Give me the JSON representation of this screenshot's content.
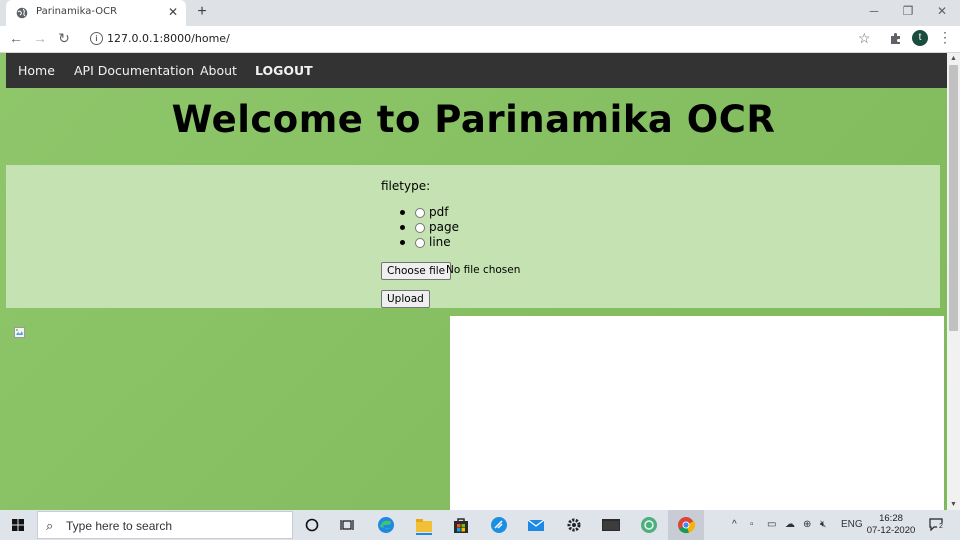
{
  "browser": {
    "tab_title": "Parinamika-OCR",
    "tab_close": "✕",
    "new_tab": "+",
    "url": "127.0.0.1:8000/home/",
    "avatar_letter": "t",
    "window_controls": {
      "minimize": "─",
      "restore": "❐",
      "close": "✕"
    }
  },
  "navbar": {
    "items": [
      {
        "label": "Home"
      },
      {
        "label": "API Documentation"
      },
      {
        "label": "About"
      },
      {
        "label": "LOGOUT"
      }
    ]
  },
  "page": {
    "heading": "Welcome to Parinamika OCR",
    "filetype_label": "filetype:",
    "filetype_options": [
      {
        "label": "pdf"
      },
      {
        "label": "page"
      },
      {
        "label": "line"
      }
    ],
    "choose_file_label": "Choose file",
    "no_file_text": "No file chosen",
    "upload_label": "Upload"
  },
  "taskbar": {
    "search_placeholder": "Type here to search",
    "language": "ENG",
    "time": "16:28",
    "date": "07-12-2020",
    "notification_count": "2"
  },
  "colors": {
    "page_bg": "#82bd5e",
    "navbar_bg": "#333333",
    "form_panel_bg": "#c5e3b2",
    "taskbar_bg": "#dfe3ea"
  }
}
